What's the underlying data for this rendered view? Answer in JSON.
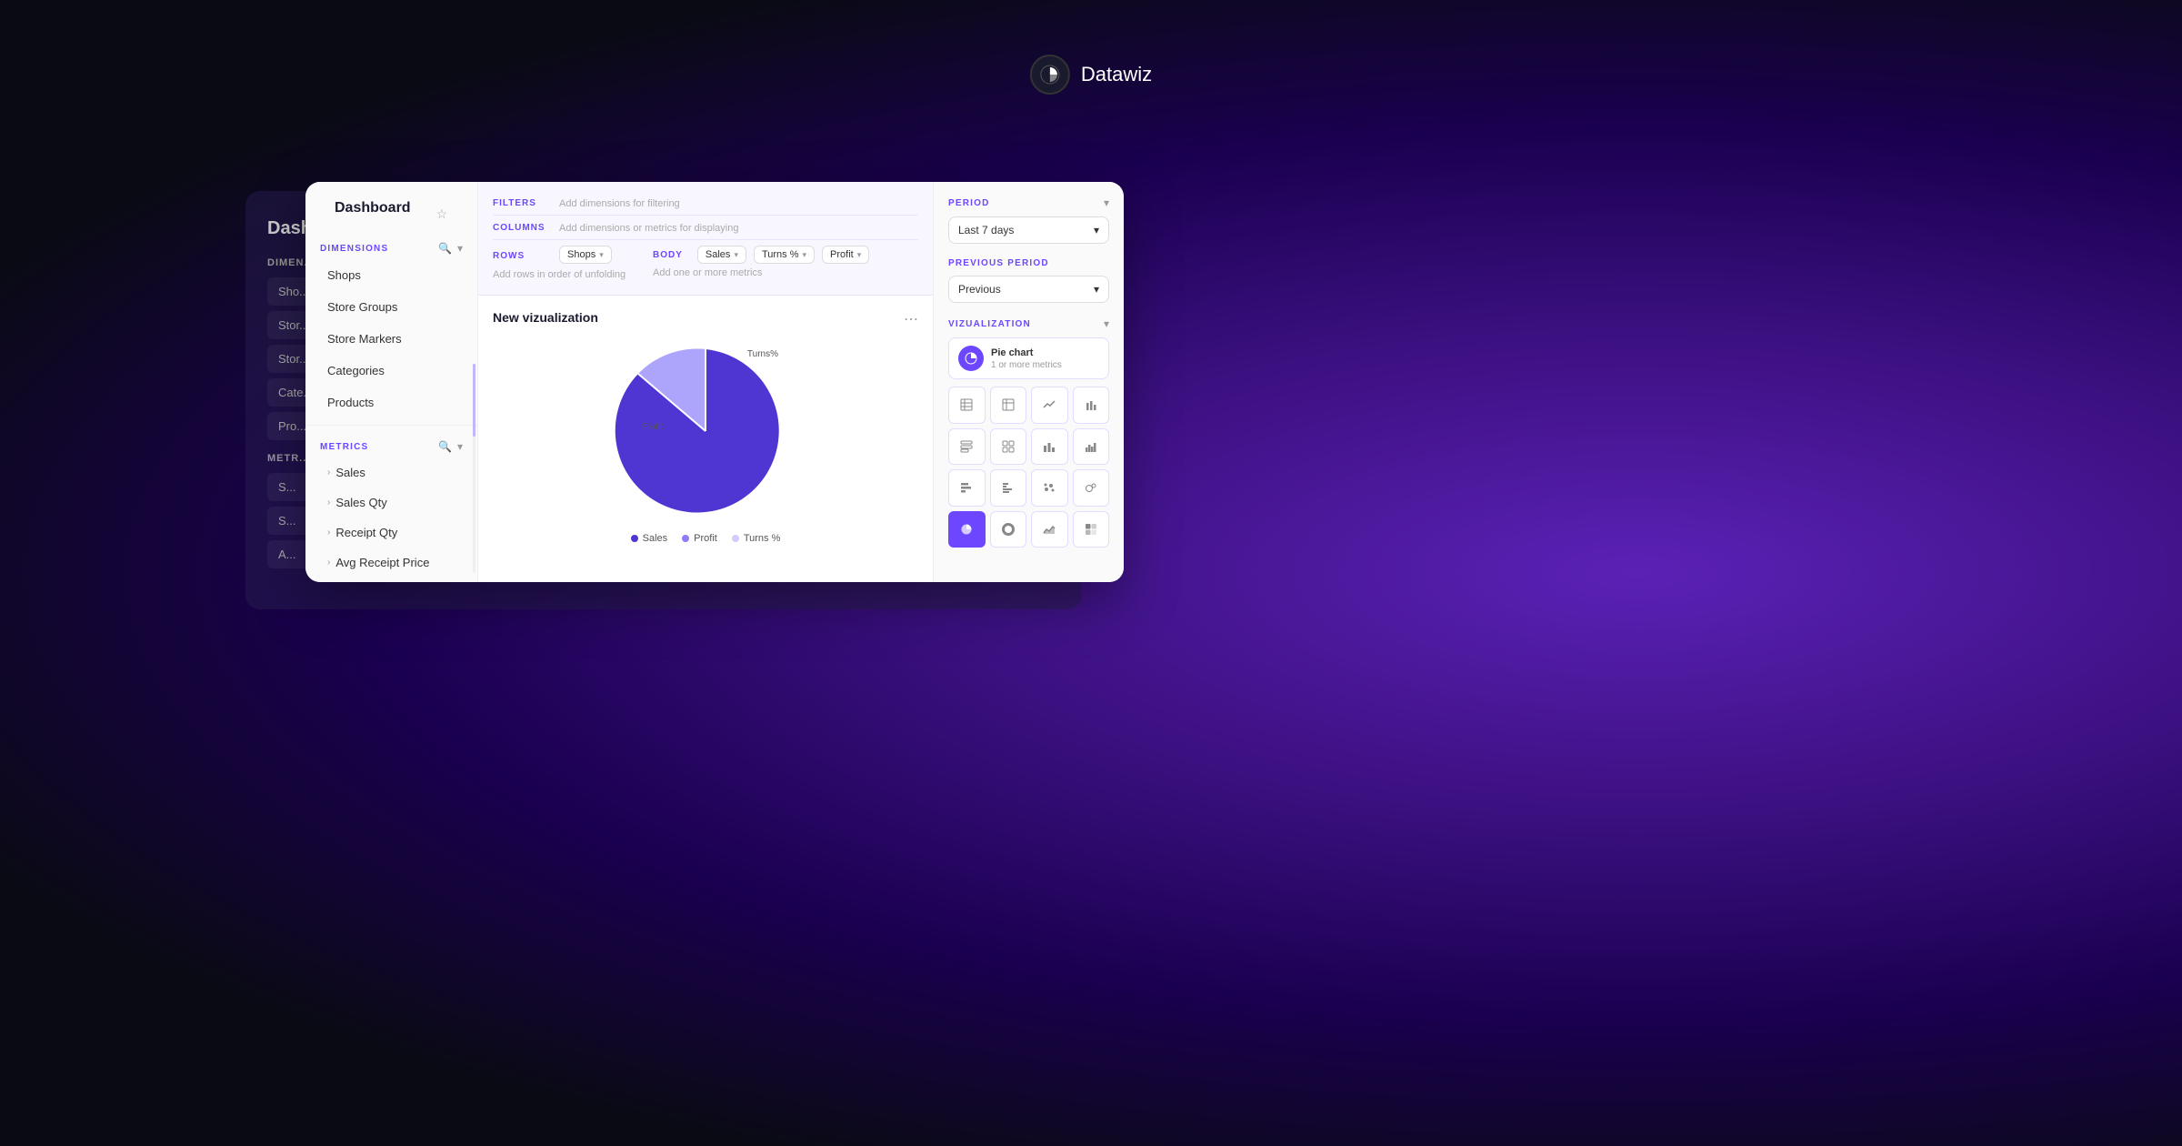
{
  "app": {
    "name": "Datawiz"
  },
  "header": {
    "dashboard_title": "Dashboard",
    "dashboard_star": "☆"
  },
  "dimensions": {
    "label": "DIMENSIONS",
    "items": [
      {
        "label": "Shops"
      },
      {
        "label": "Store Groups"
      },
      {
        "label": "Store Markers"
      },
      {
        "label": "Categories"
      },
      {
        "label": "Products"
      }
    ]
  },
  "metrics": {
    "label": "METRICS",
    "items": [
      {
        "label": "Sales"
      },
      {
        "label": "Sales Qty"
      },
      {
        "label": "Receipt Qty"
      },
      {
        "label": "Avg Receipt Price"
      }
    ]
  },
  "config": {
    "filters_label": "FILTERS",
    "filters_hint": "Add dimensions for filtering",
    "columns_label": "COLUMNS",
    "columns_hint": "Add dimensions or metrics for displaying",
    "rows_label": "ROWS",
    "rows_chip": "Shops",
    "rows_hint": "Add rows in order of unfolding",
    "body_label": "BODY",
    "body_chips": [
      "Sales",
      "Turns %",
      "Profit"
    ],
    "body_hint": "Add one or more metrics"
  },
  "chart": {
    "title": "New vizualization",
    "more_icon": "⋯",
    "labels": {
      "profit": "Profit",
      "turns": "Turns%"
    },
    "legend": [
      {
        "label": "Sales",
        "color": "#4f35d2"
      },
      {
        "label": "Profit",
        "color": "#8b7cf8"
      },
      {
        "label": "Turns %",
        "color": "#d0ccff"
      }
    ],
    "pie": {
      "sales_color": "#4f35d2",
      "profit_color": "#8b7cf8",
      "turns_color": "#d0ccff"
    }
  },
  "right_panel": {
    "period_label": "PERIOD",
    "period_value": "Last 7 days",
    "prev_period_label": "PREVIOUS PERIOD",
    "prev_period_value": "Previous",
    "viz_label": "VIZUALIZATION",
    "viz_chart_name": "Pie chart",
    "viz_chart_sub": "1 or more metrics",
    "viz_buttons": [
      {
        "icon": "▦",
        "name": "table",
        "active": false
      },
      {
        "icon": "▤",
        "name": "pivot",
        "active": false
      },
      {
        "icon": "📈",
        "name": "line",
        "active": false
      },
      {
        "icon": "📊",
        "name": "bar",
        "active": false
      },
      {
        "icon": "☰",
        "name": "list",
        "active": false
      },
      {
        "icon": "▥",
        "name": "summary",
        "active": false
      },
      {
        "icon": "▮▮",
        "name": "column-bar",
        "active": false
      },
      {
        "icon": "▯▯",
        "name": "column-bar2",
        "active": false
      },
      {
        "icon": "▭",
        "name": "hbar",
        "active": false
      },
      {
        "icon": "≡",
        "name": "hbar2",
        "active": false
      },
      {
        "icon": "⊞",
        "name": "scatter",
        "active": false
      },
      {
        "icon": "⊡",
        "name": "bubble",
        "active": false
      },
      {
        "icon": "●",
        "name": "pie",
        "active": true
      },
      {
        "icon": "○",
        "name": "donut",
        "active": false
      },
      {
        "icon": "⌒",
        "name": "area",
        "active": false
      },
      {
        "icon": "▦",
        "name": "heat",
        "active": false
      }
    ]
  },
  "shadow": {
    "title": "Dash...",
    "dim_label": "DIMEN...",
    "items": [
      "Sho...",
      "Stor...",
      "Stor...",
      "Cate...",
      "Pro..."
    ],
    "metrics_label": "METR...",
    "metrics_items": [
      "S...",
      "S...",
      "A..."
    ]
  }
}
